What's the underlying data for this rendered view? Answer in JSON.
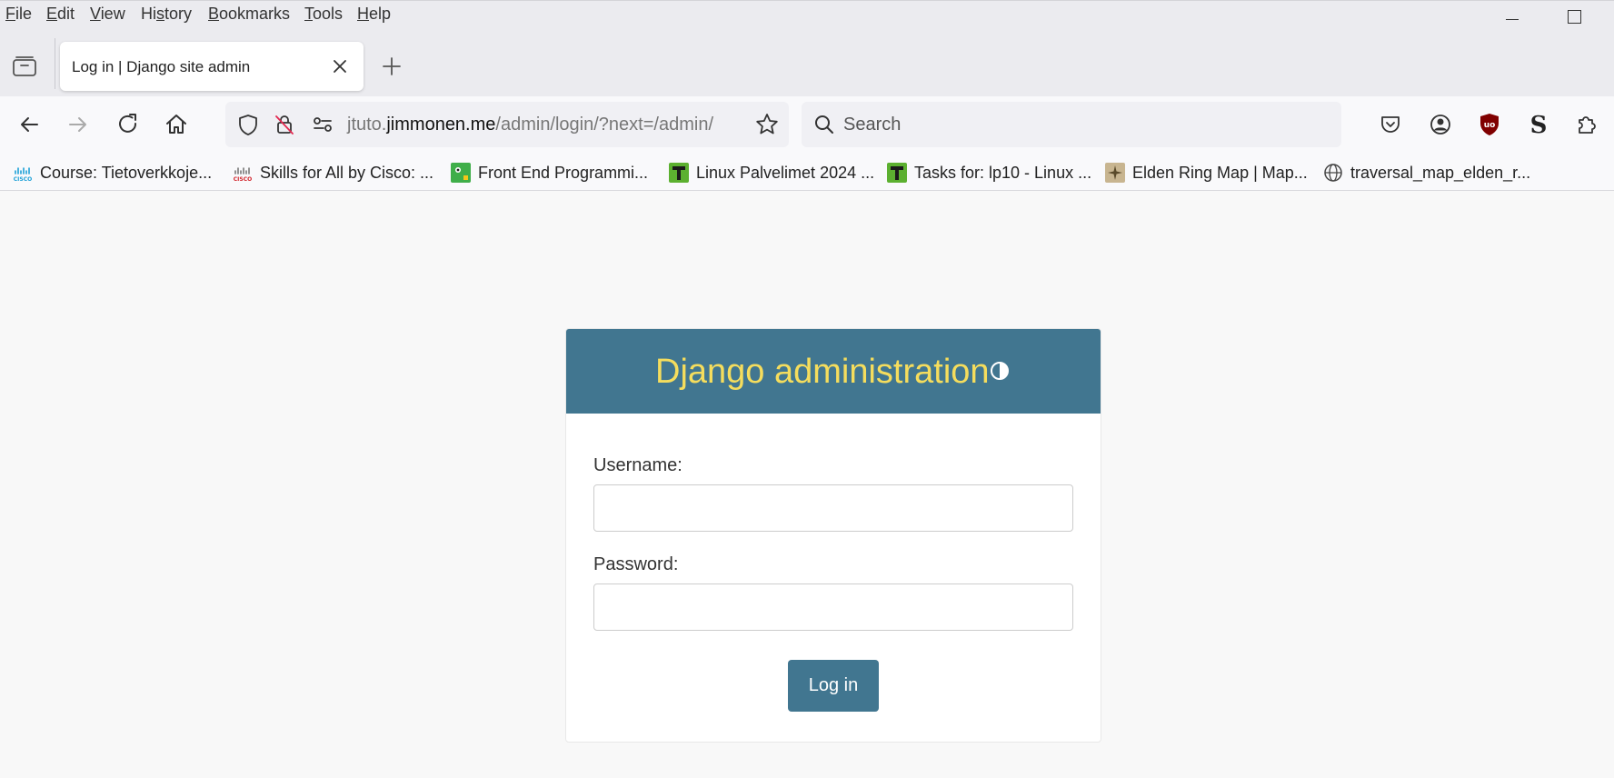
{
  "menubar": {
    "items": [
      {
        "pre": "",
        "key": "F",
        "post": "ile"
      },
      {
        "pre": "",
        "key": "E",
        "post": "dit"
      },
      {
        "pre": "",
        "key": "V",
        "post": "iew"
      },
      {
        "pre": "Hi",
        "key": "s",
        "post": "tory"
      },
      {
        "pre": "",
        "key": "B",
        "post": "ookmarks"
      },
      {
        "pre": "",
        "key": "T",
        "post": "ools"
      },
      {
        "pre": "",
        "key": "H",
        "post": "elp"
      }
    ]
  },
  "tab": {
    "title": "Log in | Django site admin"
  },
  "url": {
    "prefix": "jtuto.",
    "host": "jimmonen.me",
    "path": "/admin/login/?next=/admin/"
  },
  "search": {
    "placeholder": "Search"
  },
  "bookmarks": [
    {
      "label": "Course: Tietoverkkoje...",
      "icon": "cisco-icon"
    },
    {
      "label": "Skills for All by Cisco: ...",
      "icon": "cisco-icon"
    },
    {
      "label": "Front End Programmi...",
      "icon": "codegrade-icon"
    },
    {
      "label": "Linux Palvelimet 2024 ...",
      "icon": "terokarvinen-icon"
    },
    {
      "label": "Tasks for: lp10 - Linux ...",
      "icon": "terokarvinen-icon"
    },
    {
      "label": "Elden Ring Map | Map...",
      "icon": "map-icon"
    },
    {
      "label": "traversal_map_elden_r...",
      "icon": "globe-icon"
    }
  ],
  "login": {
    "site_name": "Django administration",
    "username_label": "Username:",
    "username_value": "",
    "password_label": "Password:",
    "password_value": "",
    "submit_label": "Log in"
  },
  "colors": {
    "header_bg": "#417690",
    "site_name": "#f5dd5d",
    "button_bg": "#417690",
    "page_bg": "#f8f8f8"
  }
}
